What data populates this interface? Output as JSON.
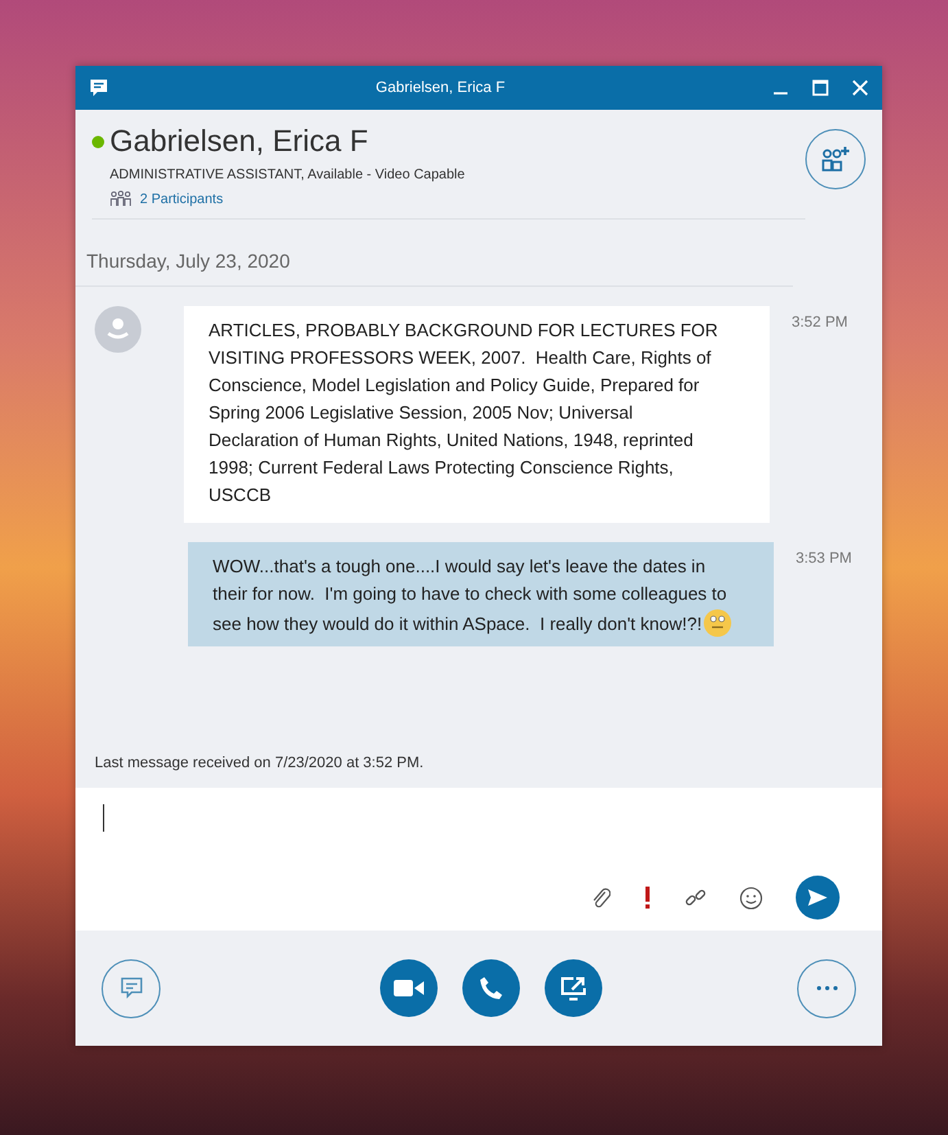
{
  "window": {
    "title": "Gabrielsen, Erica F"
  },
  "contact": {
    "name": "Gabrielsen, Erica F",
    "online": true,
    "subtitle": "ADMINISTRATIVE ASSISTANT, Available - Video Capable",
    "participants": "2 Participants"
  },
  "conversation": {
    "date": "Thursday, July 23, 2020",
    "messages": [
      {
        "kind": "received",
        "text": "ARTICLES, PROBABLY BACKGROUND FOR LECTURES FOR VISITING PROFESSORS WEEK, 2007.  Health Care, Rights of Conscience, Model Legislation and Policy Guide, Prepared for Spring 2006 Legislative Session, 2005 Nov; Universal Declaration of Human Rights, United Nations, 1948, reprinted 1998; Current Federal Laws Protecting Conscience Rights, USCCB",
        "time": "3:52 PM"
      },
      {
        "kind": "sent",
        "text": "WOW...that's a tough one....I would say let's leave the dates in their for now.  I'm going to have to check with some colleagues to see how they would do it within ASpace.  I really don't know!?!",
        "time": "3:53 PM",
        "emoji": true
      }
    ],
    "status": "Last message received on 7/23/2020 at 3:52 PM."
  }
}
